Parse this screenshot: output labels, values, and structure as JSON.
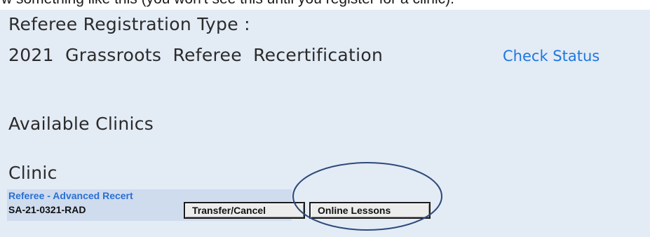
{
  "caption": {
    "text": "w something like this (you won't see this until you register for a clinic)."
  },
  "registration": {
    "label": "Referee Registration Type :",
    "value": "2021   Grassroots Referee   Recertification",
    "check_status_link": "Check Status"
  },
  "section": {
    "available_clinics": "Available Clinics",
    "clinic_header": "Clinic"
  },
  "clinic": {
    "name": "Referee - Advanced Recert",
    "code": "SA-21-0321-RAD",
    "transfer_button": "Transfer/Cancel",
    "online_lessons_button": "Online Lessons"
  },
  "colors": {
    "panel_background": "#e3ebf5",
    "row_background": "#cfdcee",
    "link_blue": "#1d77e0",
    "annotation_ellipse": "#2d4a7a"
  }
}
